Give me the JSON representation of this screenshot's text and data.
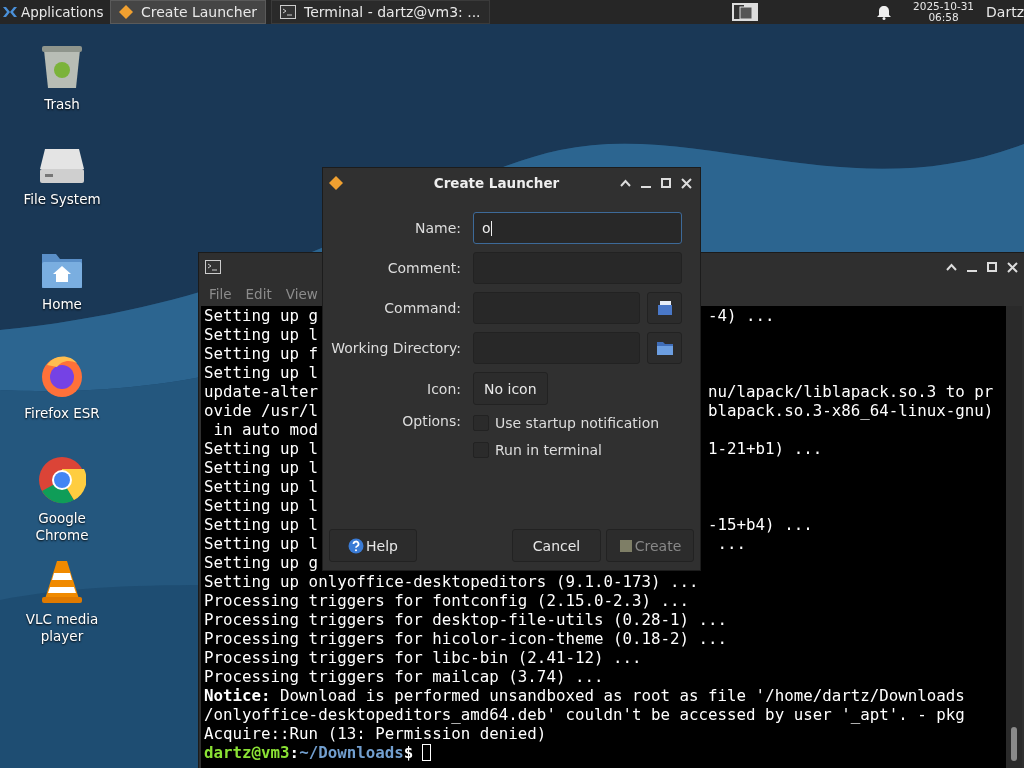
{
  "taskbar": {
    "menu_label": "Applications",
    "windows": [
      {
        "title": "Create Launcher",
        "kind": "launcher",
        "selected": true
      },
      {
        "title": "Terminal - dartz@vm3: ...",
        "kind": "terminal",
        "selected": false
      }
    ],
    "clock": {
      "date": "2025-10-31",
      "time": "06:58"
    },
    "user": "Dartz"
  },
  "desktop_icons": [
    {
      "label": "Trash",
      "kind": "trash"
    },
    {
      "label": "File System",
      "kind": "drive"
    },
    {
      "label": "Home",
      "kind": "home"
    },
    {
      "label": "Firefox ESR",
      "kind": "firefox"
    },
    {
      "label": "Google Chrome",
      "kind": "chrome"
    },
    {
      "label": "VLC media player",
      "kind": "vlc"
    }
  ],
  "terminal": {
    "menu": [
      "File",
      "Edit",
      "View"
    ],
    "lines": [
      {
        "left": "Setting up g",
        "right": "-4) ..."
      },
      {
        "left": "Setting up l"
      },
      {
        "left": "Setting up f"
      },
      {
        "left": "Setting up l"
      },
      {
        "left": "update-alter",
        "right": "nu/lapack/liblapack.so.3 to pr"
      },
      {
        "left": "ovide /usr/l",
        "right": "blapack.so.3-x86_64-linux-gnu)"
      },
      {
        "left": " in auto mod"
      },
      {
        "left": "Setting up l",
        "right": "1-21+b1) ..."
      },
      {
        "left": "Setting up l"
      },
      {
        "left": "Setting up l"
      },
      {
        "left": "Setting up l"
      },
      {
        "left": "Setting up l",
        "right": "-15+b4) ..."
      },
      {
        "left": "Setting up l",
        "right": " ..."
      },
      {
        "left": "Setting up g"
      },
      {
        "left": "Setting up onlyoffice-desktopeditors (9.1.0-173) ..."
      },
      {
        "left": "Processing triggers for fontconfig (2.15.0-2.3) ..."
      },
      {
        "left": "Processing triggers for desktop-file-utils (0.28-1) ..."
      },
      {
        "left": "Processing triggers for hicolor-icon-theme (0.18-2) ..."
      },
      {
        "left": "Processing triggers for libc-bin (2.41-12) ..."
      },
      {
        "left": "Processing triggers for mailcap (3.74) ..."
      },
      {
        "left": "**Notice:** Download is performed unsandboxed as root as file '/home/dartz/Downloads"
      },
      {
        "left": "/onlyoffice-desktopeditors_amd64.deb' couldn't be accessed by user '_apt'. - pkg"
      },
      {
        "left": "Acquire::Run (13: Permission denied)"
      }
    ],
    "prompt": {
      "user_host": "dartz@vm3",
      "separator": ":",
      "path": "~/Downloads",
      "symbol": "$"
    }
  },
  "dialog": {
    "title": "Create Launcher",
    "fields": [
      {
        "label": "Name:",
        "value": "o",
        "kind": "text",
        "focused": true
      },
      {
        "label": "Comment:",
        "kind": "text",
        "focused": false
      },
      {
        "label": "Command:",
        "kind": "file",
        "focused": false
      },
      {
        "label": "Working Directory:",
        "kind": "folder",
        "focused": false
      }
    ],
    "icon": {
      "label": "Icon:",
      "button": "No icon"
    },
    "options": {
      "label": "Options:",
      "items": [
        {
          "label": "Use startup notification",
          "checked": false
        },
        {
          "label": "Run in terminal",
          "checked": false
        }
      ]
    },
    "buttons": {
      "help": "Help",
      "cancel": "Cancel",
      "create": "Create",
      "create_disabled": true
    }
  }
}
